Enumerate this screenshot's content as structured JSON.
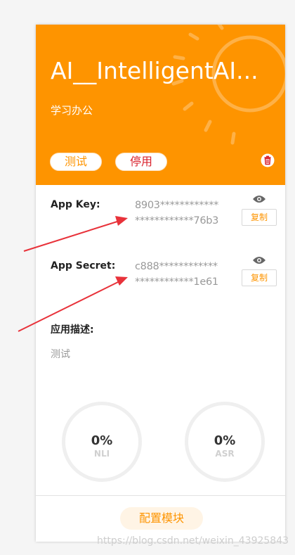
{
  "app": {
    "title": "AI__IntelligentAI...",
    "category": "学习办公",
    "test_label": "测试",
    "disable_label": "停用",
    "icons": {
      "delete": "trash-icon",
      "reveal": "eye-icon"
    }
  },
  "fields": {
    "app_key": {
      "label": "App Key:",
      "line1": "8903************",
      "line2": "************76b3",
      "copy_label": "复制"
    },
    "app_secret": {
      "label": "App Secret:",
      "line1": "c888************",
      "line2": "************1e61",
      "copy_label": "复制"
    }
  },
  "description": {
    "label": "应用描述:",
    "text": "测试"
  },
  "stats": {
    "nli": {
      "value": "0%",
      "label": "NLI"
    },
    "asr": {
      "value": "0%",
      "label": "ASR"
    }
  },
  "footer": {
    "config_label": "配置模块"
  },
  "watermark": "https://blog.csdn.net/weixin_43925843",
  "colors": {
    "accent": "#fe9400",
    "danger": "#d9202b",
    "annotation": "#e8323a"
  }
}
